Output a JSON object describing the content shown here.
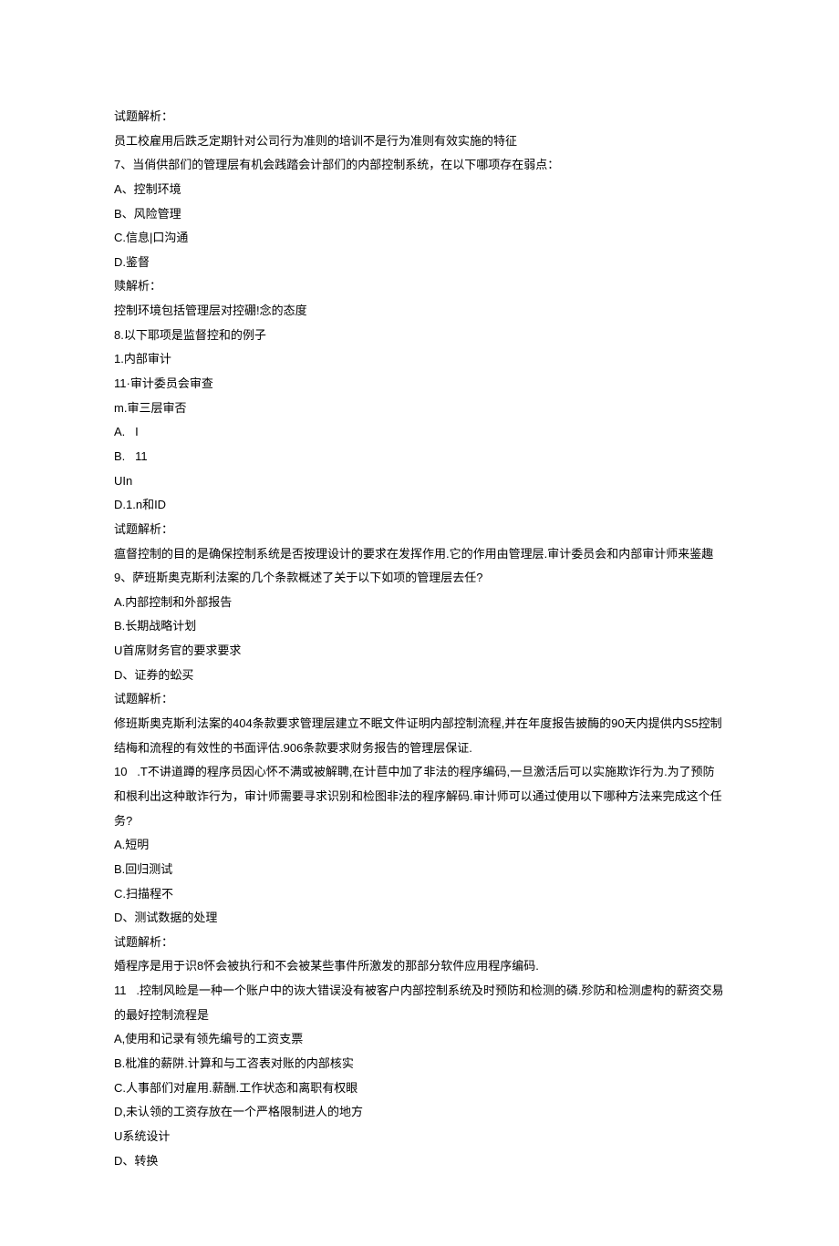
{
  "lines": [
    "试题解析：",
    "员工校雇用后跌乏定期针对公司行为准则的培训不是行为准则有效实施的特征",
    "7、当俏供部们的管理层有机会践踏会计部们的内部控制系统，在以下哪项存在弱点：",
    "A、控制环境",
    "B、风险管理",
    "C.信息|口沟通",
    "D.鉴督",
    "赎解析：",
    "控制环境包括管理层对控硼!念的态度",
    "8.以下耶项是监督控和的例子",
    "1.内部审计",
    "11·审计委员会审查",
    "m.审三层审否",
    "A.   I",
    "B.   11",
    "UIn",
    "D.1.n和ID",
    "试题解析：",
    "瘟督控制的目的是确保控制系统是否按理设计的要求在发挥作用.它的作用由管理层.审计委员会和内部审计师来鉴趣",
    "9、萨班斯奥克斯利法案的几个条款概述了关于以下如项的管理层去任?",
    "A.内部控制和外部报告",
    "B.长期战略计划",
    "U首席财务官的要求要求",
    "D、证券的蚣买",
    "试题解析：",
    "修班斯奥克斯利法案的404条款要求管理层建立不眠文件证明内部控制流程,并在年度报告披酶的90天内提供内S5控制结梅和流程的有效性的书面评估.906条款要求财务报告的管理层保证.",
    "10   .T不讲道蹲的程序员因心怀不满或被解聘,在计苣中加了非法的程序编码,一旦激活后可以实施欺诈行为.为了预防和根利出这种敢诈行为，审计师需要寻求识别和检图非法的程序解码.审计师可以通过使用以下哪种方法来完成这个任务?",
    "A.短明",
    "B.回归测试",
    "C.扫描程不",
    "D、测试数据的处理",
    "试题解析：",
    "婚程序是用于识8怀会被执行和不会被某些事件所激发的那部分软件应用程序编码.",
    "11   .控制风睑是一种一个账户中的诙大错误没有被客户内部控制系统及时预防和检测的磷.殄防和检测虚构的薪资交易的最好控制流程是",
    "A,使用和记录有领先编号的工资支票",
    "B.枇准的薪阱.计算和与工咨表对账的内部核实",
    "C.人事部们对雇用.薪酬.工作状态和离职有权眼",
    "D,未认领的工资存放在一个严格限制进人的地方",
    "U系统设计",
    "D、转换"
  ]
}
